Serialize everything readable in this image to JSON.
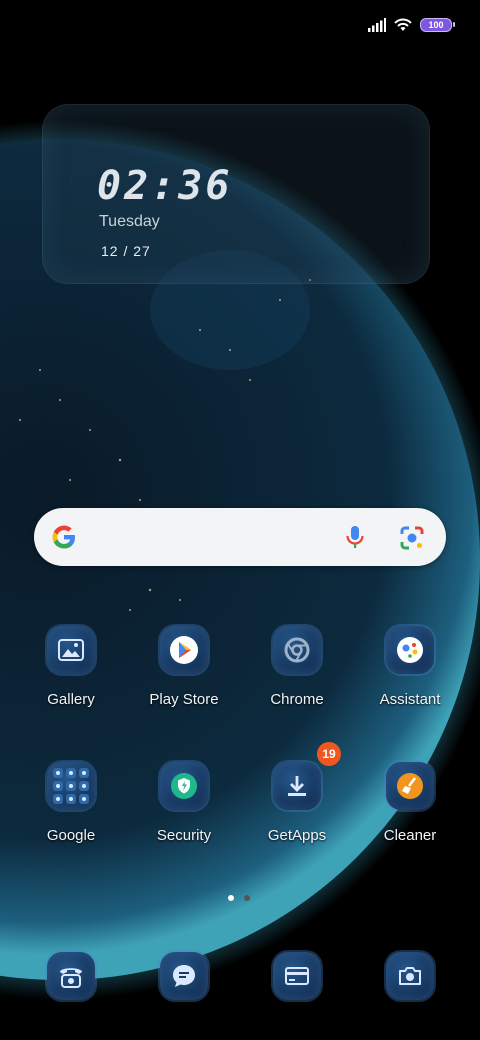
{
  "status_bar": {
    "battery_level": "100",
    "icons": [
      "signal-icon",
      "wifi-icon",
      "battery-icon"
    ]
  },
  "clock_widget": {
    "time": "02:36",
    "day": "Tuesday",
    "date": "12 / 27"
  },
  "search_bar": {
    "icons": [
      "google-logo-icon",
      "microphone-icon",
      "google-lens-icon"
    ]
  },
  "apps_row1": [
    {
      "label": "Gallery",
      "icon": "gallery-icon"
    },
    {
      "label": "Play Store",
      "icon": "play-store-icon"
    },
    {
      "label": "Chrome",
      "icon": "chrome-icon"
    },
    {
      "label": "Assistant",
      "icon": "assistant-icon"
    }
  ],
  "apps_row2": [
    {
      "label": "Google",
      "icon": "google-folder-icon"
    },
    {
      "label": "Security",
      "icon": "security-icon"
    },
    {
      "label": "GetApps",
      "icon": "getapps-icon",
      "badge": "19"
    },
    {
      "label": "Cleaner",
      "icon": "cleaner-icon"
    }
  ],
  "page_indicator": {
    "pages": 2,
    "current": 1
  },
  "dock": [
    {
      "icon": "phone-icon"
    },
    {
      "icon": "messages-icon"
    },
    {
      "icon": "wallet-icon"
    },
    {
      "icon": "camera-icon"
    }
  ],
  "colors": {
    "badge": "#f0561f",
    "icon_bg": "#173a63",
    "battery": "#7e57e0"
  }
}
